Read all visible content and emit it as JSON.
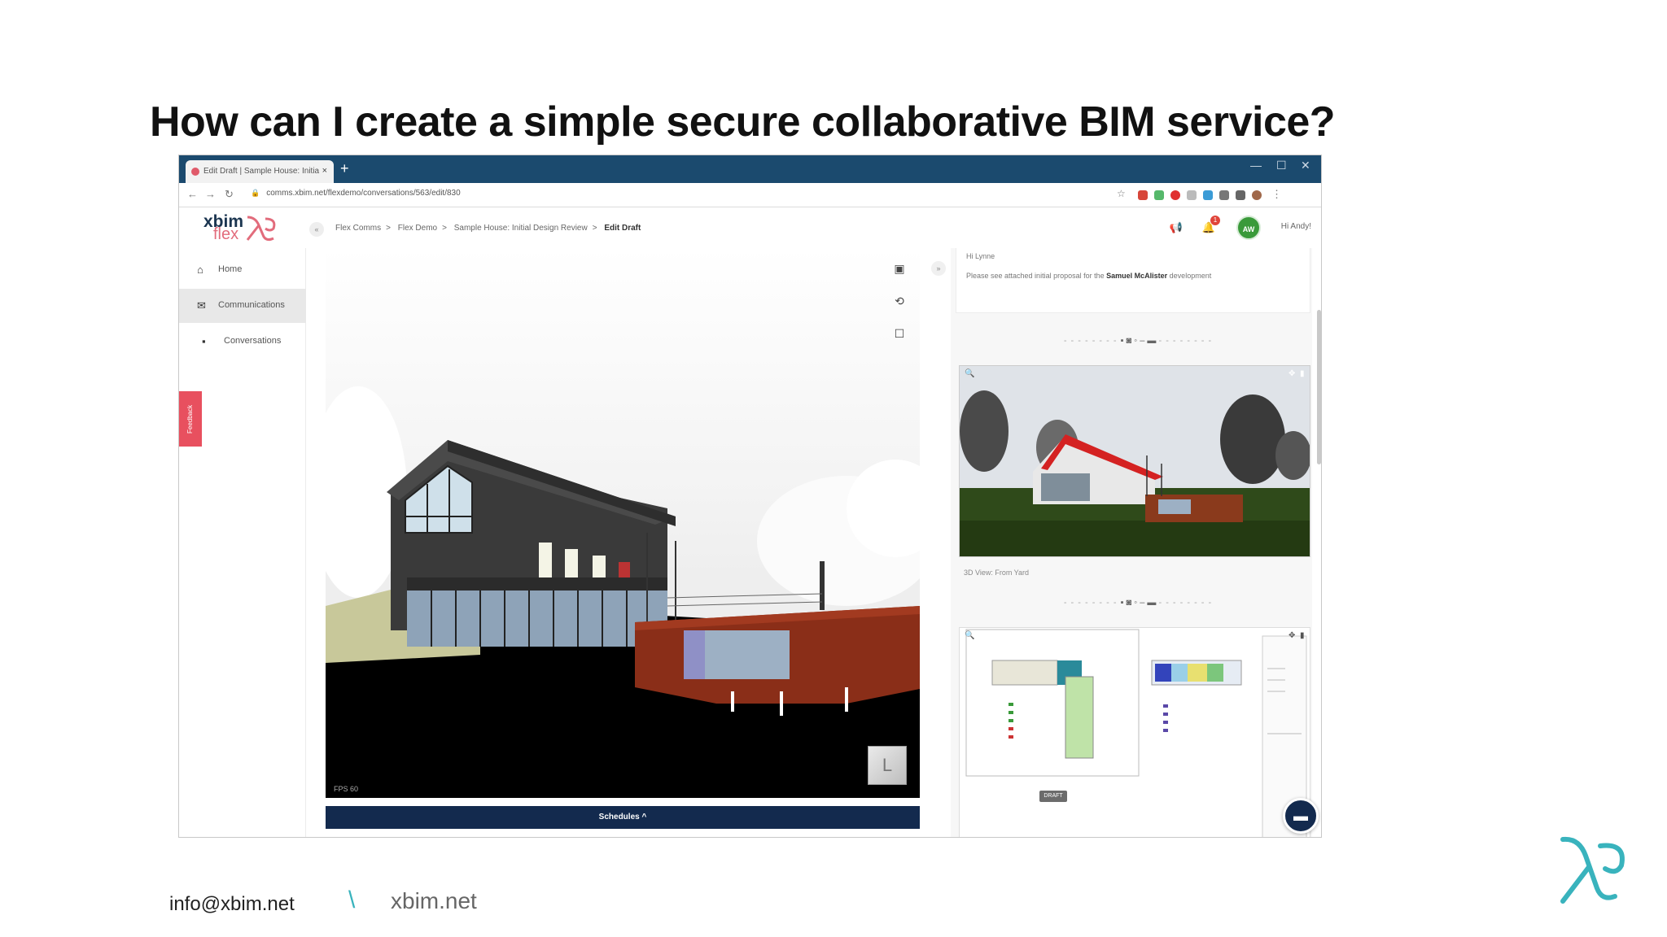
{
  "slide": {
    "title": "How can I create a simple secure collaborative BIM service?"
  },
  "browser": {
    "tab_title": "Edit Draft | Sample House: Initia",
    "tab_close": "×",
    "new_tab": "+",
    "win_min": "—",
    "win_max": "☐",
    "win_close": "✕",
    "url": "comms.xbim.net/flexdemo/conversations/563/edit/830"
  },
  "app": {
    "logo_line1": "xbim",
    "logo_line2": "flex",
    "breadcrumb": [
      "Flex Comms",
      "Flex Demo",
      "Sample House: Initial Design Review",
      "Edit Draft"
    ],
    "breadcrumb_sep": ">",
    "notification_count": "1",
    "avatar_initials": "AW",
    "greeting": "Hi Andy!"
  },
  "sidebar": {
    "items": [
      {
        "label": "Home",
        "icon": "home-icon"
      },
      {
        "label": "Communications",
        "icon": "envelope-icon"
      },
      {
        "label": "Conversations",
        "icon": "chat-icon"
      }
    ],
    "feedback_label": "Feedback"
  },
  "viewer": {
    "fps_label": "FPS 60",
    "cube_face": "L",
    "schedules_label": "Schedules ^"
  },
  "panel": {
    "greeting": "Hi Lynne",
    "message_prefix": "Please see attached initial proposal for the",
    "message_bold": "Samuel McAlister",
    "message_suffix": "development",
    "caption_1": "3D View: From Yard",
    "draft_badge": "DRAFT"
  },
  "footer": {
    "email": "info@xbim.net",
    "slash": "\\",
    "site": "xbim.net"
  },
  "colors": {
    "tabbar": "#1b4a6e",
    "navy": "#132a4e",
    "feedback": "#e8505f",
    "teal": "#39b3bd",
    "avatar": "#3a9a3a"
  }
}
